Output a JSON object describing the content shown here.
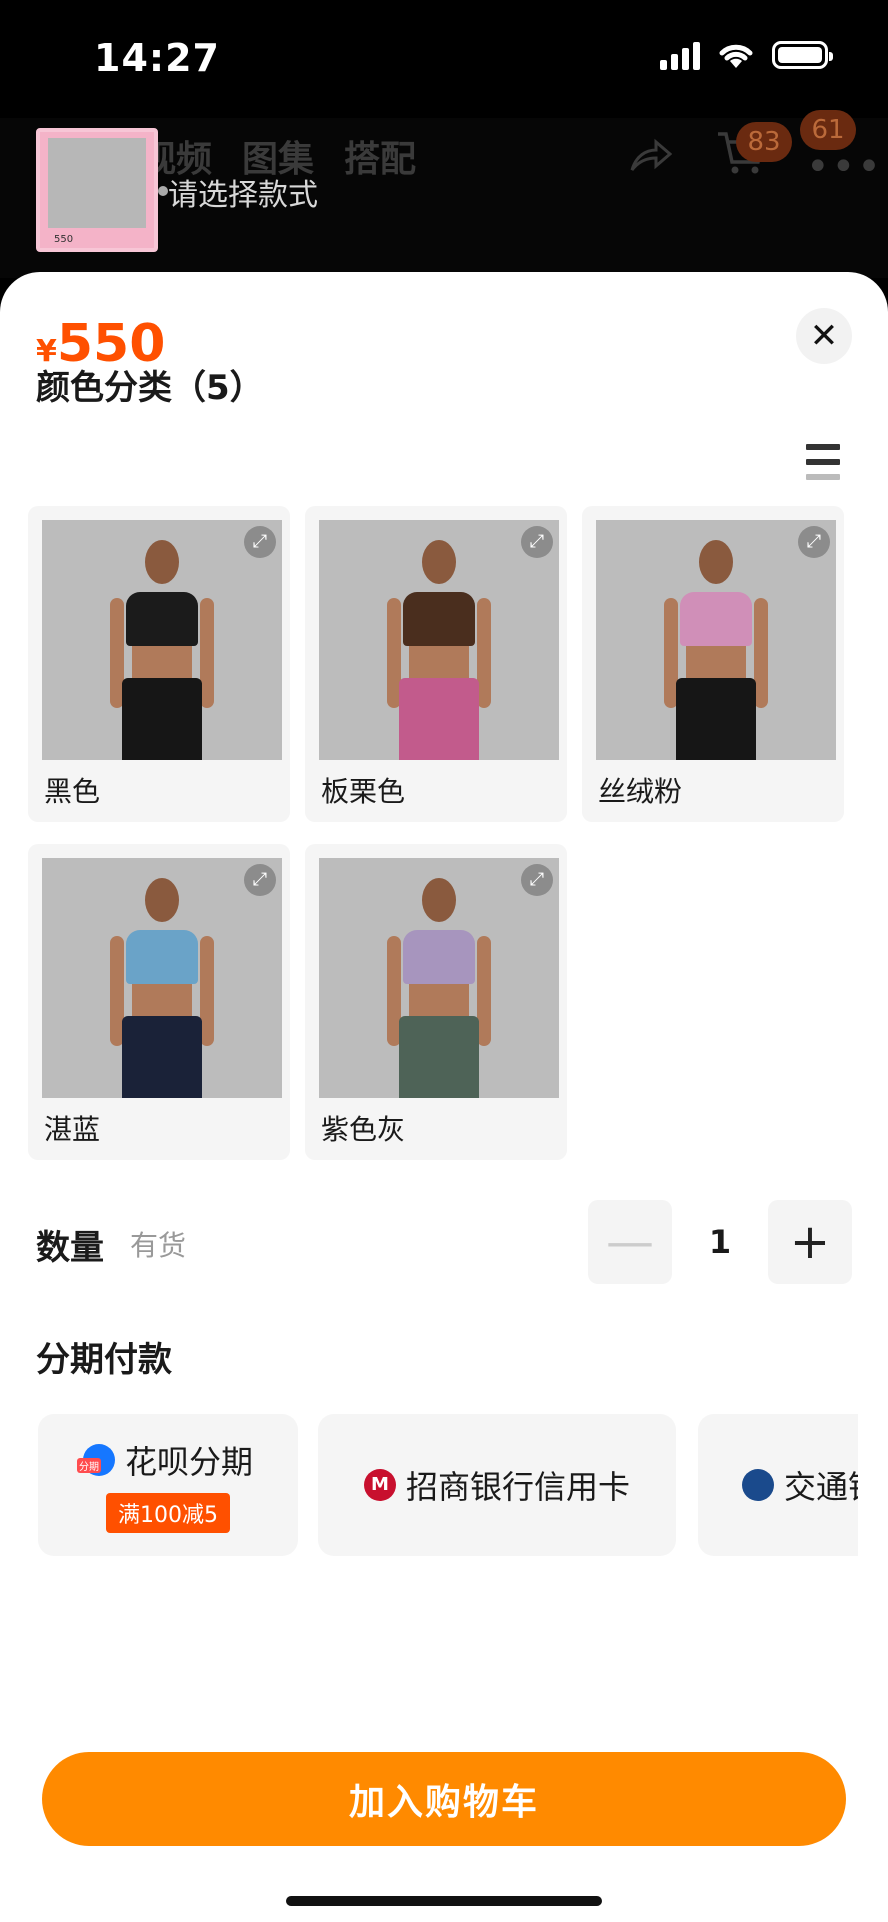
{
  "status": {
    "time": "14:27"
  },
  "header": {
    "thumb_price": "550",
    "tabs": [
      "视频",
      "图集",
      "搭配"
    ],
    "select_hint": "请选择款式",
    "cart_count": "83",
    "more_count": "61"
  },
  "sheet": {
    "price_symbol": "¥",
    "price": "550",
    "close_label": "✕"
  },
  "colors": {
    "title": "颜色分类（5）",
    "items": [
      {
        "label": "黑色",
        "top": "#1b1b1b",
        "bottom": "#161616"
      },
      {
        "label": "板栗色",
        "top": "#4a2e1e",
        "bottom": "#c25b8c"
      },
      {
        "label": "丝绒粉",
        "top": "#d08fb8",
        "bottom": "#161616"
      },
      {
        "label": "湛蓝",
        "top": "#6aa3c8",
        "bottom": "#1a2238"
      },
      {
        "label": "紫色灰",
        "top": "#a795be",
        "bottom": "#4e6357"
      }
    ]
  },
  "quantity": {
    "title": "数量",
    "stock": "有货",
    "value": "1",
    "minus": "—",
    "plus": "+"
  },
  "installment": {
    "title": "分期付款",
    "options": [
      {
        "label": "花呗分期",
        "badge": "满100减5"
      },
      {
        "label": "招商银行信用卡"
      },
      {
        "label": "交通银行信用卡"
      }
    ]
  },
  "footer": {
    "cart_button": "加入购物车"
  }
}
